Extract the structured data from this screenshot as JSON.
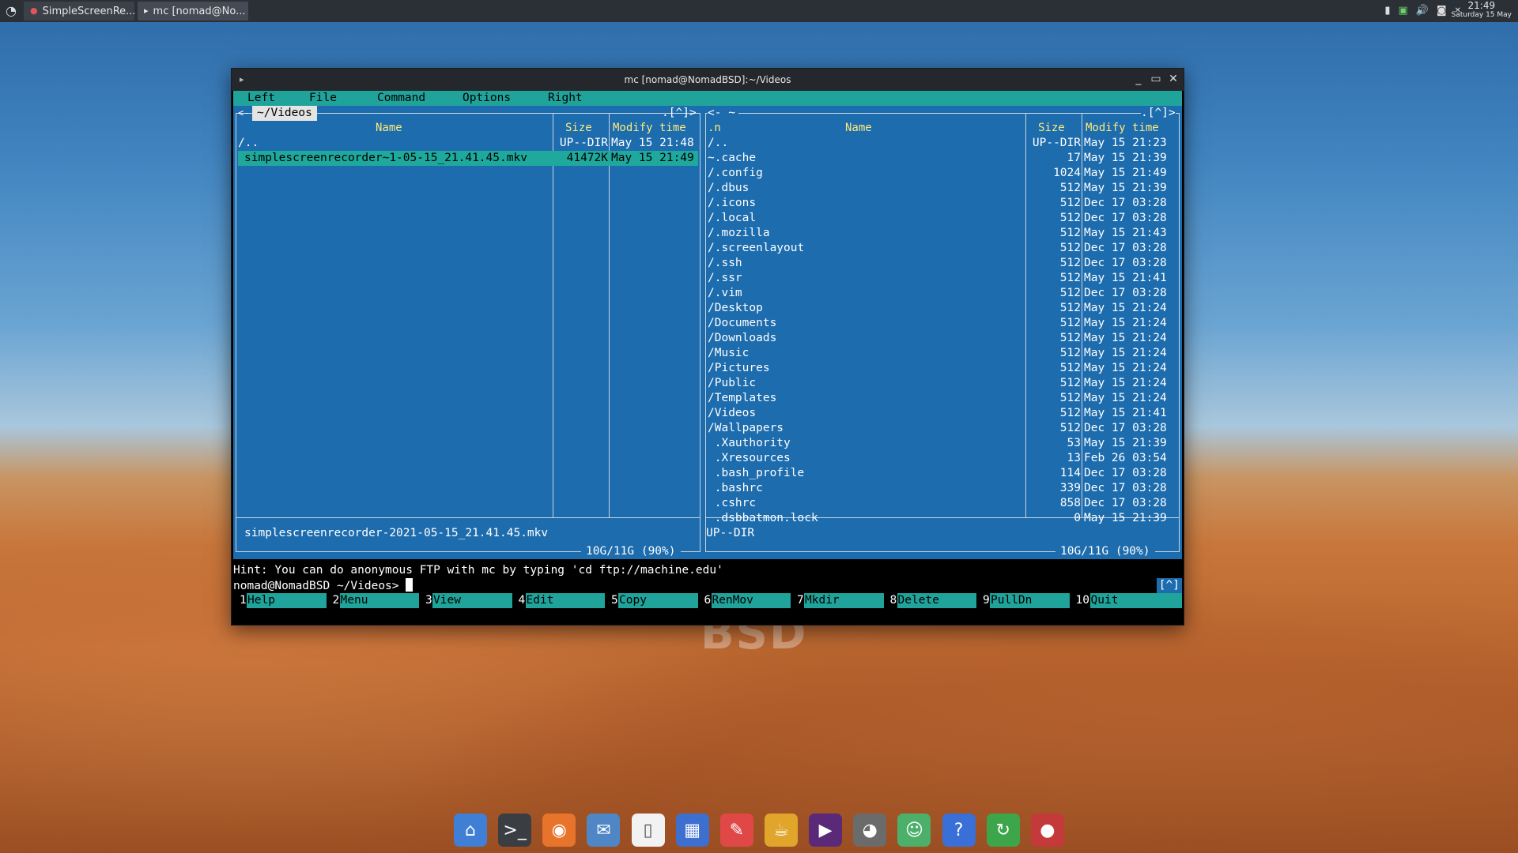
{
  "taskbar": {
    "tasks": [
      {
        "label": "SimpleScreenRe...",
        "icon": "record-icon"
      },
      {
        "label": "mc [nomad@No...",
        "icon": "terminal-icon"
      }
    ],
    "clock_time": "21:49",
    "clock_date": "Saturday 15 May"
  },
  "window": {
    "title": "mc [nomad@NomadBSD]:~/Videos"
  },
  "mc": {
    "menu": [
      "Left",
      "File",
      "Command",
      "Options",
      "Right"
    ],
    "left_panel": {
      "path": "~/Videos",
      "path_prefix": "<-",
      "history": ".[^]>",
      "columns": {
        "name": "Name",
        "size": "Size",
        "mtime": "Modify time"
      },
      "rows": [
        {
          "name": "/..",
          "size": "UP--DIR",
          "mtime": "May 15 21:48"
        },
        {
          "name": "simplescreenrecorder~1-05-15_21.41.45.mkv",
          "size": "41472K",
          "mtime": "May 15 21:49"
        }
      ],
      "status": "simplescreenrecorder-2021-05-15_21.41.45.mkv",
      "disk": "10G/11G (90%)"
    },
    "right_panel": {
      "path": "<- ~",
      "history": ".[^]>",
      "columns": {
        "sort": ".n",
        "name": "Name",
        "size": "Size",
        "mtime": "Modify time"
      },
      "rows": [
        {
          "name": "/..",
          "size": "UP--DIR",
          "mtime": "May 15 21:23"
        },
        {
          "name": "~.cache",
          "size": "17",
          "mtime": "May 15 21:39"
        },
        {
          "name": "/.config",
          "size": "1024",
          "mtime": "May 15 21:49"
        },
        {
          "name": "/.dbus",
          "size": "512",
          "mtime": "May 15 21:39"
        },
        {
          "name": "/.icons",
          "size": "512",
          "mtime": "Dec 17 03:28"
        },
        {
          "name": "/.local",
          "size": "512",
          "mtime": "Dec 17 03:28"
        },
        {
          "name": "/.mozilla",
          "size": "512",
          "mtime": "May 15 21:43"
        },
        {
          "name": "/.screenlayout",
          "size": "512",
          "mtime": "Dec 17 03:28"
        },
        {
          "name": "/.ssh",
          "size": "512",
          "mtime": "Dec 17 03:28"
        },
        {
          "name": "/.ssr",
          "size": "512",
          "mtime": "May 15 21:41"
        },
        {
          "name": "/.vim",
          "size": "512",
          "mtime": "Dec 17 03:28"
        },
        {
          "name": "/Desktop",
          "size": "512",
          "mtime": "May 15 21:24"
        },
        {
          "name": "/Documents",
          "size": "512",
          "mtime": "May 15 21:24"
        },
        {
          "name": "/Downloads",
          "size": "512",
          "mtime": "May 15 21:24"
        },
        {
          "name": "/Music",
          "size": "512",
          "mtime": "May 15 21:24"
        },
        {
          "name": "/Pictures",
          "size": "512",
          "mtime": "May 15 21:24"
        },
        {
          "name": "/Public",
          "size": "512",
          "mtime": "May 15 21:24"
        },
        {
          "name": "/Templates",
          "size": "512",
          "mtime": "May 15 21:24"
        },
        {
          "name": "/Videos",
          "size": "512",
          "mtime": "May 15 21:41"
        },
        {
          "name": "/Wallpapers",
          "size": "512",
          "mtime": "Dec 17 03:28"
        },
        {
          "name": " .Xauthority",
          "size": "53",
          "mtime": "May 15 21:39"
        },
        {
          "name": " .Xresources",
          "size": "13",
          "mtime": "Feb 26 03:54"
        },
        {
          "name": " .bash_profile",
          "size": "114",
          "mtime": "Dec 17 03:28"
        },
        {
          "name": " .bashrc",
          "size": "339",
          "mtime": "Dec 17 03:28"
        },
        {
          "name": " .cshrc",
          "size": "858",
          "mtime": "Dec 17 03:28"
        },
        {
          "name": " .dsbbatmon.lock",
          "size": "0",
          "mtime": "May 15 21:39"
        }
      ],
      "status": "UP--DIR",
      "disk": "10G/11G (90%)"
    },
    "hint": "Hint: You can do anonymous FTP with mc by typing 'cd ftp://machine.edu'",
    "prompt": "nomad@NomadBSD ~/Videos> ",
    "caret_button": "[^]",
    "fkeys": [
      {
        "num": "1",
        "label": "Help"
      },
      {
        "num": "2",
        "label": "Menu"
      },
      {
        "num": "3",
        "label": "View"
      },
      {
        "num": "4",
        "label": "Edit"
      },
      {
        "num": "5",
        "label": "Copy"
      },
      {
        "num": "6",
        "label": "RenMov"
      },
      {
        "num": "7",
        "label": "Mkdir"
      },
      {
        "num": "8",
        "label": "Delete"
      },
      {
        "num": "9",
        "label": "PullDn"
      },
      {
        "num": "10",
        "label": "Quit"
      }
    ]
  },
  "desktop": {
    "watermark": "BSD"
  },
  "dock": {
    "apps": [
      {
        "icon": "home-folder-icon",
        "glyph": "⌂",
        "color": "#3f7fd6"
      },
      {
        "icon": "terminal-icon",
        "glyph": ">_",
        "color": "#3a3d42"
      },
      {
        "icon": "firefox-icon",
        "glyph": "◉",
        "color": "#e8732a"
      },
      {
        "icon": "thunderbird-icon",
        "glyph": "✉",
        "color": "#4f86c6"
      },
      {
        "icon": "text-document-icon",
        "glyph": "▯",
        "color": "#f2f2f2"
      },
      {
        "icon": "calculator-icon",
        "glyph": "▦",
        "color": "#3d6fd1"
      },
      {
        "icon": "text-editor-icon",
        "glyph": "✎",
        "color": "#e04848"
      },
      {
        "icon": "package-manager-icon",
        "glyph": "☕",
        "color": "#e0a52a"
      },
      {
        "icon": "media-player-icon",
        "glyph": "▶",
        "color": "#5a2a78"
      },
      {
        "icon": "gimp-icon",
        "glyph": "◕",
        "color": "#6b6b6b"
      },
      {
        "icon": "pidgin-icon",
        "glyph": "☺",
        "color": "#4caf6a"
      },
      {
        "icon": "help-icon",
        "glyph": "?",
        "color": "#3a6fd8"
      },
      {
        "icon": "update-icon",
        "glyph": "↻",
        "color": "#3da64a"
      },
      {
        "icon": "screen-recorder-icon",
        "glyph": "●",
        "color": "#c43a3a"
      }
    ]
  }
}
